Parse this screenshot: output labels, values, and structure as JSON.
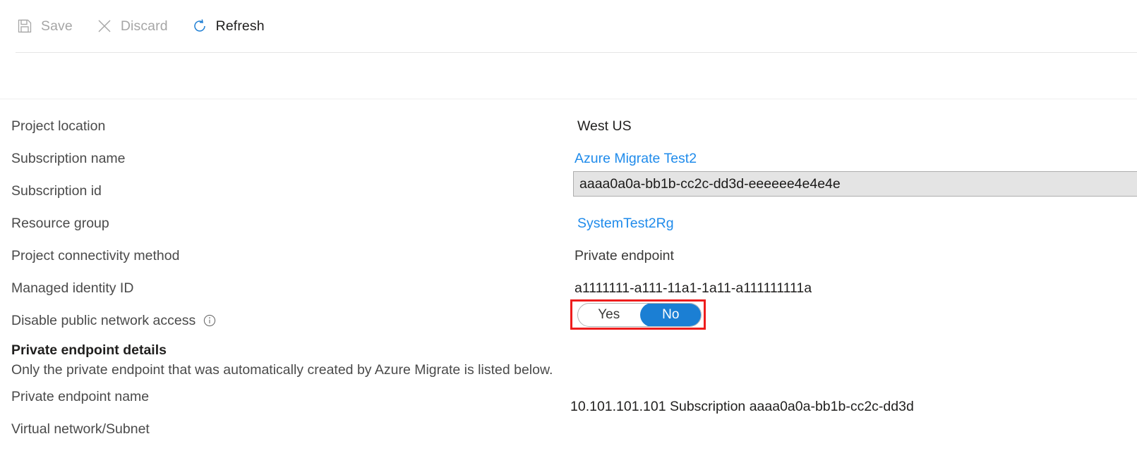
{
  "toolbar": {
    "items": [
      {
        "label": "Save",
        "icon": "save-icon",
        "state": "disabled"
      },
      {
        "label": "Discard",
        "icon": "discard-icon",
        "state": "disabled"
      },
      {
        "label": "Refresh",
        "icon": "refresh-icon",
        "state": "enabled"
      }
    ]
  },
  "properties": {
    "labels": [
      "Project location",
      "Subscription name",
      "Subscription id",
      "Resource group",
      "Project connectivity method",
      "Managed identity ID",
      "Disable public network access"
    ],
    "project_location": "West US",
    "subscription_name": "Azure Migrate Test2",
    "subscription_id": "aaaa0a0a-bb1b-cc2c-dd3d-eeeeee4e4e4e",
    "resource_group": "SystemTest2Rg",
    "connectivity_method": "Private endpoint",
    "managed_identity_id": "a1111111-a111-11a1-1a11-a111111111a"
  },
  "toggle": {
    "option_yes": "Yes",
    "option_no": "No",
    "selected": "No",
    "accent_color": "#1b7fd4",
    "highlight_color": "#ee1d1d"
  },
  "private_endpoint_section": {
    "title": "Private endpoint details",
    "subtitle": "Only the private endpoint that was automatically created by Azure Migrate is listed below.",
    "label_name": "Private endpoint name",
    "label_vnet": "Virtual network/Subnet",
    "endpoint_value": "10.101.101.101 Subscription aaaa0a0a-bb1b-cc2c-dd3d"
  }
}
